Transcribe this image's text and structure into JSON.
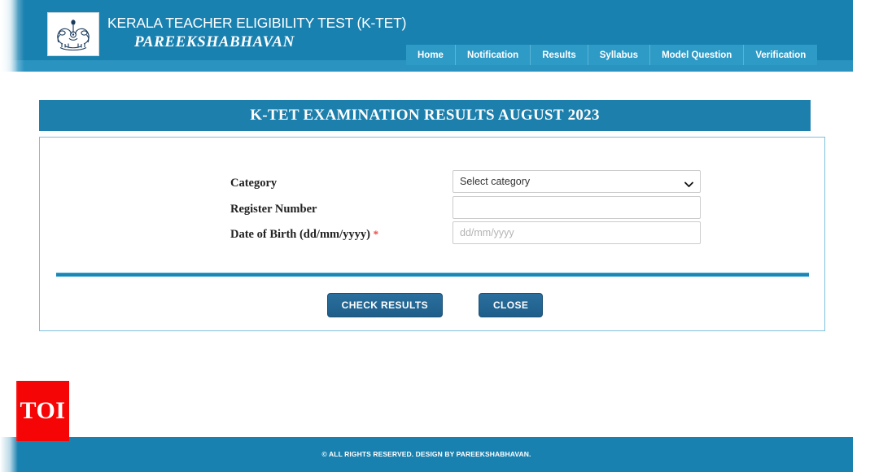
{
  "header": {
    "emblem_icon": "kerala-government-emblem-icon",
    "title_main": "KERALA TEACHER ELIGIBILITY TEST (K-TET)",
    "title_sub": "PAREEKSHABHAVAN",
    "background_color": "#1981b0"
  },
  "nav": {
    "items": [
      {
        "label": "Home"
      },
      {
        "label": "Notification"
      },
      {
        "label": "Results"
      },
      {
        "label": "Syllabus"
      },
      {
        "label": "Model Question"
      },
      {
        "label": "Verification"
      }
    ],
    "background_color": "#2e9ac6"
  },
  "banner": {
    "title": "K-TET EXAMINATION RESULTS AUGUST 2023",
    "background_color": "#1c7fac"
  },
  "form": {
    "category": {
      "label": "Category",
      "selected": "Select category",
      "options": [
        "Select category"
      ],
      "chevron_icon": "chevron-down-icon"
    },
    "register_number": {
      "label": "Register Number",
      "value": "",
      "placeholder": ""
    },
    "dob": {
      "label": "Date of Birth (dd/mm/yyyy)",
      "required_marker": "*",
      "value": "",
      "placeholder": "dd/mm/yyyy"
    },
    "divider_color": "#1b85b3"
  },
  "buttons": {
    "check_results": "CHECK RESULTS",
    "close": "CLOSE",
    "color": "#1f5e8a"
  },
  "footer": {
    "text": "© ALL RIGHTS RESERVED. DESIGN BY PAREEKSHABHAVAN.",
    "background_color": "#1981b0"
  },
  "watermark": {
    "text": "TOI",
    "background_color": "#f50505"
  }
}
